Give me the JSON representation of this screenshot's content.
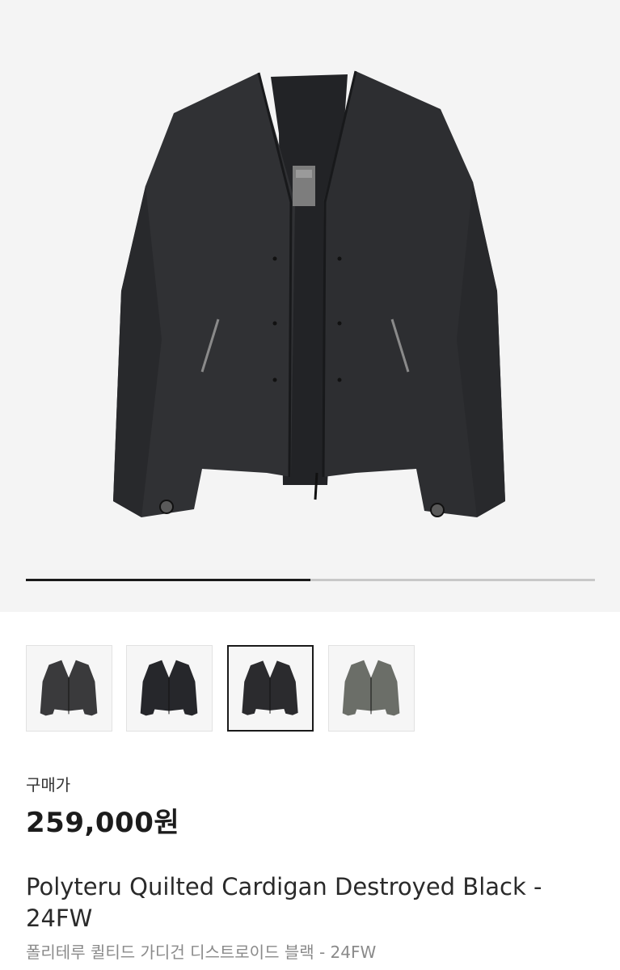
{
  "gallery": {
    "progress_fraction": 0.5,
    "thumbnails": [
      {
        "alt": "charcoal-jacket-thumbnail",
        "tone": "#3a3a3c",
        "active": false
      },
      {
        "alt": "black-jacket-thumbnail",
        "tone": "#26272b",
        "active": false
      },
      {
        "alt": "black-jacket-alt-thumbnail",
        "tone": "#2b2b2e",
        "active": true
      },
      {
        "alt": "destroyed-grey-jacket-thumbnail",
        "tone": "#6b6e68",
        "active": false
      }
    ]
  },
  "product": {
    "price_label": "구매가",
    "price": "259,000원",
    "title": "Polyteru Quilted Cardigan Destroyed Black - 24FW",
    "subtitle": "폴리테루 퀼티드 가디건 디스트로이드 블랙 - 24FW"
  },
  "colors": {
    "hero_bg": "#f4f4f4",
    "jacket": "#2f3033",
    "progress_fill": "#1a1a1a",
    "progress_track": "#c8c8c8"
  }
}
